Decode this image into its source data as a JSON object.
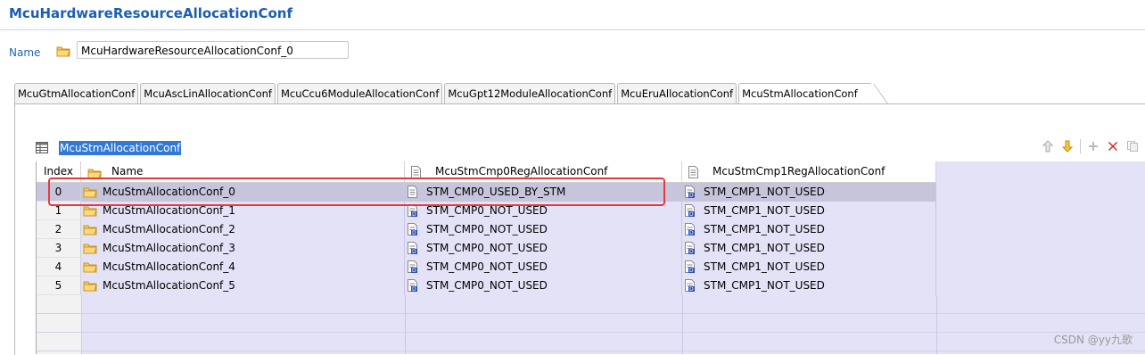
{
  "page": {
    "title": "McuHardwareResourceAllocationConf",
    "name_label": "Name",
    "name_value": "McuHardwareResourceAllocationConf_0"
  },
  "tabs": [
    {
      "label": "McuGtmAllocationConf",
      "active": false
    },
    {
      "label": "McuAscLinAllocationConf",
      "active": false
    },
    {
      "label": "McuCcu6ModuleAllocationConf",
      "active": false
    },
    {
      "label": "McuGpt12ModuleAllocationConf",
      "active": false
    },
    {
      "label": "McuEruAllocationConf",
      "active": false
    },
    {
      "label": "McuStmAllocationConf",
      "active": true
    }
  ],
  "table": {
    "title": "McuStmAllocationConf",
    "columns": {
      "index": "Index",
      "name": "Name",
      "reg0": "McuStmCmp0RegAllocationConf",
      "reg1": "McuStmCmp1RegAllocationConf"
    },
    "rows": [
      {
        "index": "0",
        "name": "McuStmAllocationConf_0",
        "reg0": "STM_CMP0_USED_BY_STM",
        "reg1": "STM_CMP1_NOT_USED",
        "selected": true
      },
      {
        "index": "1",
        "name": "McuStmAllocationConf_1",
        "reg0": "STM_CMP0_NOT_USED",
        "reg1": "STM_CMP1_NOT_USED"
      },
      {
        "index": "2",
        "name": "McuStmAllocationConf_2",
        "reg0": "STM_CMP0_NOT_USED",
        "reg1": "STM_CMP1_NOT_USED"
      },
      {
        "index": "3",
        "name": "McuStmAllocationConf_3",
        "reg0": "STM_CMP0_NOT_USED",
        "reg1": "STM_CMP1_NOT_USED"
      },
      {
        "index": "4",
        "name": "McuStmAllocationConf_4",
        "reg0": "STM_CMP0_NOT_USED",
        "reg1": "STM_CMP1_NOT_USED"
      },
      {
        "index": "5",
        "name": "McuStmAllocationConf_5",
        "reg0": "STM_CMP0_NOT_USED",
        "reg1": "STM_CMP1_NOT_USED"
      }
    ]
  },
  "toolbar": {
    "icons": [
      "move-up-icon",
      "move-down-icon",
      "add-icon",
      "delete-icon",
      "copy-icon"
    ]
  },
  "colors": {
    "title": "#1a5fb4",
    "selection": "#3179d6",
    "grid_bg": "#e4e2f6",
    "highlight": "#e83a3a"
  },
  "watermark": "CSDN @yy九歌"
}
